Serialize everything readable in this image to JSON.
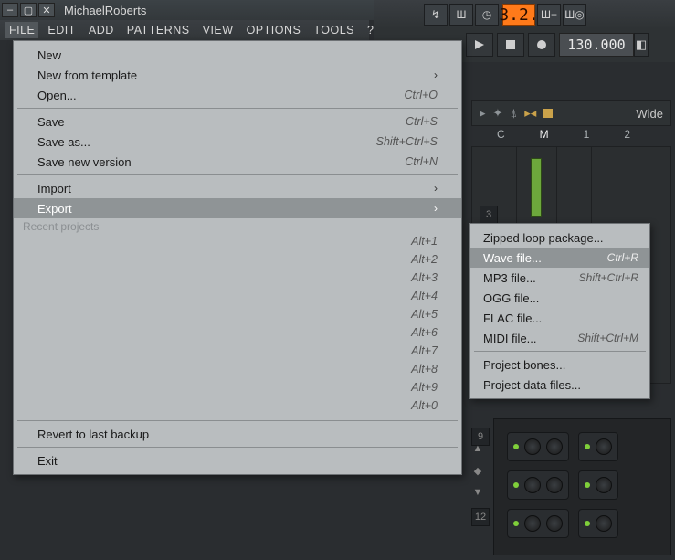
{
  "title": "MichaelRoberts",
  "menubar": [
    "FILE",
    "EDIT",
    "ADD",
    "PATTERNS",
    "VIEW",
    "OPTIONS",
    "TOOLS",
    "?"
  ],
  "top": {
    "magnet_icon": "↯",
    "pat_icon": "Ш",
    "clock_icon": "◷",
    "counter": "3.2.",
    "pat_plus": "Ш+",
    "pat_rec": "Ш◎"
  },
  "transport": {
    "play": "▶",
    "stop": "■",
    "rec": "●",
    "tempo": "130.000"
  },
  "file_menu": {
    "new": "New",
    "new_from_template": "New from template",
    "open": "Open...",
    "open_sc": "Ctrl+O",
    "save": "Save",
    "save_sc": "Ctrl+S",
    "save_as": "Save as...",
    "save_as_sc": "Shift+Ctrl+S",
    "save_new_version": "Save new version",
    "save_new_version_sc": "Ctrl+N",
    "import": "Import",
    "export": "Export",
    "recent_header": "Recent projects",
    "recent_slots": [
      "Alt+1",
      "Alt+2",
      "Alt+3",
      "Alt+4",
      "Alt+5",
      "Alt+6",
      "Alt+7",
      "Alt+8",
      "Alt+9",
      "Alt+0"
    ],
    "revert": "Revert to last backup",
    "exit": "Exit"
  },
  "export_menu": {
    "zip": "Zipped loop package...",
    "wave": "Wave file...",
    "wave_sc": "Ctrl+R",
    "mp3": "MP3 file...",
    "mp3_sc": "Shift+Ctrl+R",
    "ogg": "OGG file...",
    "flac": "FLAC file...",
    "midi": "MIDI file...",
    "midi_sc": "Shift+Ctrl+M",
    "bones": "Project bones...",
    "datafiles": "Project data files..."
  },
  "mixer": {
    "wide": "Wide",
    "labels": {
      "c": "C",
      "m": "M",
      "one": "1",
      "two": "2"
    }
  },
  "slots": {
    "s3": "3",
    "s9": "9",
    "s12": "12"
  }
}
